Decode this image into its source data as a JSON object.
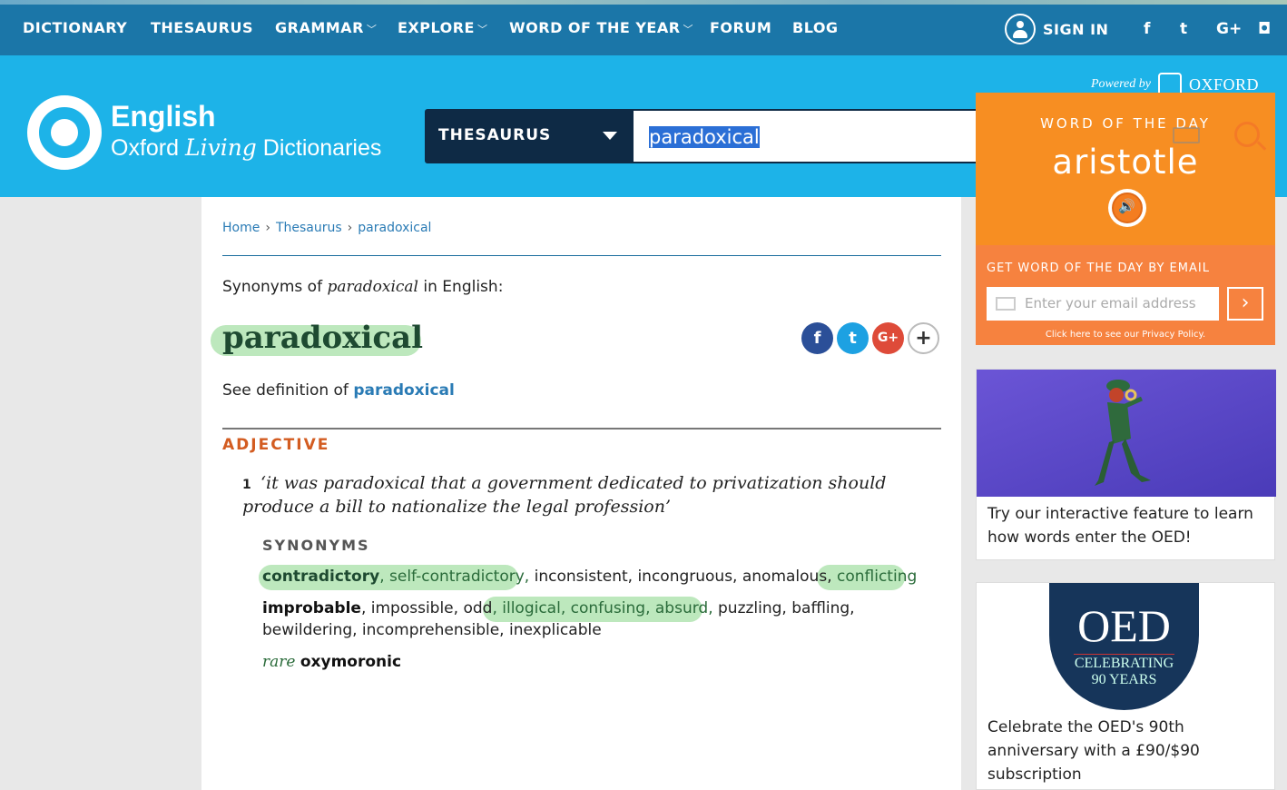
{
  "topnav": {
    "items": [
      {
        "label": "DICTIONARY",
        "dropdown": false
      },
      {
        "label": "THESAURUS",
        "dropdown": false
      },
      {
        "label": "GRAMMAR",
        "dropdown": true
      },
      {
        "label": "EXPLORE",
        "dropdown": true
      },
      {
        "label": "WORD OF THE YEAR",
        "dropdown": true
      },
      {
        "label": "FORUM",
        "dropdown": false
      },
      {
        "label": "BLOG",
        "dropdown": false
      }
    ],
    "signin": "SIGN IN",
    "social": [
      "facebook-icon",
      "twitter-icon",
      "google-plus-icon",
      "instagram-icon"
    ],
    "social_glyphs": {
      "facebook": "f",
      "twitter": "t",
      "gplus": "G+",
      "instagram": "◘"
    }
  },
  "header": {
    "logo_line1": "English",
    "logo_line2a": "Oxford ",
    "logo_line2b": "Living",
    "logo_line2c": " Dictionaries",
    "powered_by": "Powered by",
    "oxford": "OXFORD"
  },
  "search": {
    "scope": "THESAURUS",
    "query": "paradoxical"
  },
  "wotd": {
    "heading": "WORD OF THE DAY",
    "word": "aristotle",
    "email_label": "GET WORD OF THE DAY BY EMAIL",
    "email_placeholder": "Enter your email address",
    "submit": "›",
    "privacy": "Click here to see our Privacy Policy."
  },
  "breadcrumb": [
    "Home",
    "Thesaurus",
    "paradoxical"
  ],
  "entry": {
    "synonyms_of_a": "Synonyms of ",
    "synonyms_of_word": "paradoxical",
    "synonyms_of_b": " in English:",
    "headword": "paradoxical",
    "see_def_text": "See definition of ",
    "see_def_link": "paradoxical",
    "pos": "ADJECTIVE",
    "sense_number": "1",
    "example": "‘it was paradoxical that a government dedicated to privatization should produce a bill to nationalize the legal profession’",
    "syn_heading": "SYNONYMS",
    "line1": {
      "contradictory": "contradictory",
      "self": "self-contradictory,",
      "rest": " inconsistent, incongruous, anomalous, ",
      "conflicting": "conflicting"
    },
    "line2": {
      "improbable": "improbable",
      "rest_a": ", impossible, odd",
      "illogical": ", illogical,",
      "confusing": " confusing,",
      "absurd": " absurd,",
      "rest_b": " puzzling, baffling,"
    },
    "line3": "bewildering, incomprehensible, inexplicable",
    "rare_label": "rare",
    "rare_word": "oxymoronic"
  },
  "promos": {
    "oed_feature": "Try our interactive feature to learn how words enter the OED!",
    "oed_seal_title": "OED",
    "oed_seal_sub1": "CELEBRATING",
    "oed_seal_sub2": "90 YEARS",
    "oed_90": "Celebrate the OED's 90th anniversary with a £90/$90 subscription"
  },
  "colors": {
    "nav_bg": "#1b76a8",
    "header_bg": "#1db3e8",
    "wotd_bg": "#f78e22",
    "pos_color": "#d35c21",
    "link": "#2a7bb5",
    "highlight": "#bde8bd"
  }
}
